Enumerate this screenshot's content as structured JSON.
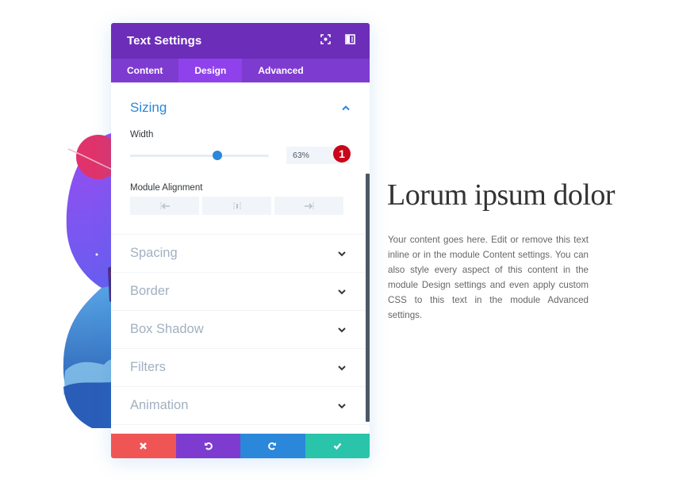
{
  "panel": {
    "title": "Text Settings",
    "header_icons": [
      "expand-icon",
      "sidebar-toggle-icon"
    ],
    "tabs": [
      {
        "label": "Content",
        "active": false
      },
      {
        "label": "Design",
        "active": true
      },
      {
        "label": "Advanced",
        "active": false
      }
    ],
    "sizing": {
      "title": "Sizing",
      "expanded": true,
      "width_label": "Width",
      "width_value": "63%",
      "width_slider_fraction": 0.63,
      "badge": "1",
      "alignment_label": "Module Alignment",
      "alignment_options": [
        "left-align-icon",
        "center-align-icon",
        "right-align-icon"
      ]
    },
    "sections": [
      {
        "title": "Spacing"
      },
      {
        "title": "Border"
      },
      {
        "title": "Box Shadow"
      },
      {
        "title": "Filters"
      },
      {
        "title": "Animation"
      }
    ],
    "footer": {
      "buttons": [
        {
          "name": "cancel",
          "icon": "close-icon",
          "color": "#ef5555"
        },
        {
          "name": "undo",
          "icon": "undo-icon",
          "color": "#7e3bd0"
        },
        {
          "name": "redo",
          "icon": "redo-icon",
          "color": "#2b87da"
        },
        {
          "name": "save",
          "icon": "check-icon",
          "color": "#29c4a9"
        }
      ]
    }
  },
  "content": {
    "heading": "Lorum ipsum dolor",
    "body": "Your content goes here. Edit or remove this text inline or in the module Content settings. You can also style every aspect of this content in the module Design settings and even apply custom CSS to this text in the module Advanced settings."
  },
  "colors": {
    "header": "#6c2eb9",
    "tabs": "#7e3bd0",
    "active_tab": "#8f42ec",
    "accent": "#2b87da",
    "badge": "#c8071a"
  }
}
